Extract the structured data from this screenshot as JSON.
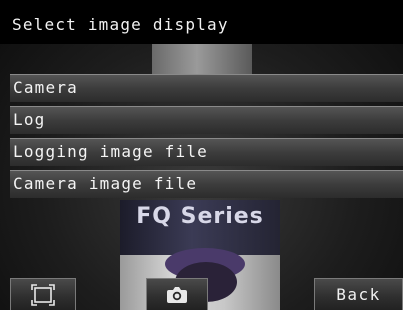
{
  "header": {
    "title": "Select image display"
  },
  "menu": {
    "items": [
      {
        "label": "Camera"
      },
      {
        "label": "Log"
      },
      {
        "label": "Logging image file"
      },
      {
        "label": "Camera image file"
      }
    ]
  },
  "background": {
    "product_label_text": "FQ Series"
  },
  "toolbar": {
    "frame_button_icon": "frame-corners-icon",
    "camera_button_icon": "camera-icon",
    "back_label": "Back"
  },
  "colors": {
    "menu_item_bg": "#3d3d3d",
    "text": "#f4f4f4",
    "header_bg": "#000000"
  }
}
